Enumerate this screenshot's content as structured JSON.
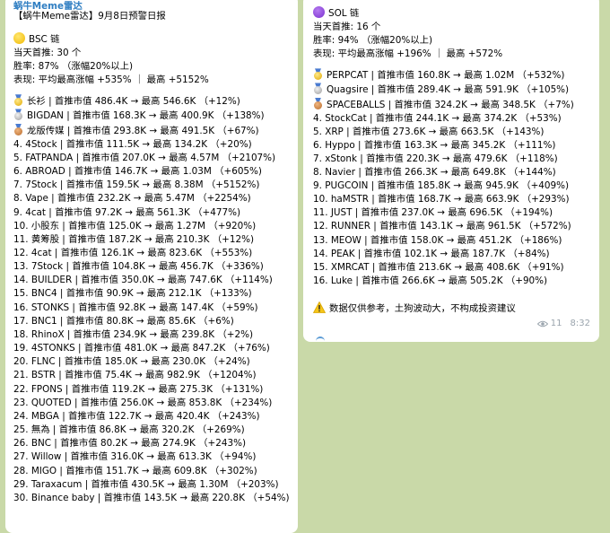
{
  "left": {
    "sender": "蜗牛Meme雷达",
    "title": "【蜗牛Meme雷达】9月8日预警日报",
    "chain": "BSC 链",
    "today": "当天首推: 30 个",
    "winrate": "胜率: 87% （涨幅20%以上)",
    "perf": "表现: 平均最高涨幅 +535% ｜ 最高 +5152%",
    "medal_rows": [
      {
        "medal": "gold",
        "text": "长衫 | 首推市值 486.4K → 最高 546.6K （+12%)"
      },
      {
        "medal": "silver",
        "text": "BIGDAN | 首推市值 168.3K → 最高 400.9K （+138%)"
      },
      {
        "medal": "bronze",
        "text": "龙版传媒 | 首推市值 293.8K → 最高 491.5K （+67%)"
      }
    ],
    "rows": [
      "4. 4Stock | 首推市值 111.5K → 最高 134.2K （+20%)",
      "5. FATPANDA | 首推市值 207.0K → 最高 4.57M （+2107%)",
      "6. ABROAD | 首推市值 146.7K → 最高 1.03M （+605%)",
      "7. 7Stock | 首推市值 159.5K → 最高 8.38M （+5152%)",
      "8. Vape | 首推市值 232.2K → 最高 5.47M （+2254%)",
      "9. 4cat | 首推市值 97.2K → 最高 561.3K （+477%)",
      "10. 小股东 | 首推市值 125.0K → 最高 1.27M （+920%)",
      "11. 黄筹股 | 首推市值 187.2K → 最高 210.3K （+12%)",
      "12. 4cat | 首推市值 126.1K → 最高 823.6K （+553%)",
      "13. 7Stock | 首推市值 104.8K → 最高 456.7K （+336%)",
      "14. BUILDER | 首推市值 350.0K → 最高 747.6K （+114%)",
      "15. BNC4 | 首推市值 90.9K → 最高 212.1K （+133%)",
      "16. STONKS | 首推市值 92.8K → 最高 147.4K （+59%)",
      "17. BNC1 | 首推市值 80.8K → 最高 85.6K （+6%)",
      "18. RhinoX | 首推市值 234.9K → 最高 239.8K （+2%)",
      "19. 4STONKS | 首推市值 481.0K → 最高 847.2K （+76%)",
      "20. FLNC | 首推市值 185.0K → 最高 230.0K （+24%)",
      "21. BSTR | 首推市值 75.4K → 最高 982.9K （+1204%)",
      "22. FPONS | 首推市值 119.2K → 最高 275.3K （+131%)",
      "23. QUOTED | 首推市值 256.0K → 最高 853.8K （+234%)",
      "24. MBGA | 首推市值 122.7K → 最高 420.4K （+243%)",
      "25. 無為 | 首推市值 86.8K → 最高 320.2K （+269%)",
      "26. BNC | 首推市值 80.2K → 最高 274.9K （+243%)",
      "27. Willow | 首推市值 316.0K → 最高 613.3K （+94%)",
      "28. MIGO | 首推市值 151.7K → 最高 609.8K （+302%)",
      "29. Taraxacum | 首推市值 430.5K → 最高 1.30M （+203%)",
      "30. Binance baby | 首推市值 143.5K → 最高 220.8K （+54%)"
    ]
  },
  "right": {
    "chain": "SOL 链",
    "today": "当天首推: 16 个",
    "winrate": "胜率: 94% （涨幅20%以上)",
    "perf": "表现: 平均最高涨幅 +196% ｜ 最高 +572%",
    "medal_rows": [
      {
        "medal": "gold",
        "text": "PERPCAT | 首推市值 160.8K → 最高 1.02M （+532%)"
      },
      {
        "medal": "silver",
        "text": "Quagsire | 首推市值 289.4K → 最高 591.9K （+105%)"
      },
      {
        "medal": "bronze",
        "text": "SPACEBALLS | 首推市值 324.2K → 最高 348.5K （+7%)"
      }
    ],
    "rows": [
      "4. StockCat | 首推市值 244.1K → 最高 374.2K （+53%)",
      "5. XRP | 首推市值 273.6K → 最高 663.5K （+143%)",
      "6. Hyppo | 首推市值 163.3K → 最高 345.2K （+111%)",
      "7. xStonk | 首推市值 220.3K → 最高 479.6K （+118%)",
      "8. Navier | 首推市值 266.3K → 最高 649.8K （+144%)",
      "9. PUGCOIN | 首推市值 185.8K → 最高 945.9K （+409%)",
      "10. haMSTR | 首推市值 168.7K → 最高 663.9K （+293%)",
      "11. JUST | 首推市值 237.0K → 最高 696.5K （+194%)",
      "12. RUNNER | 首推市值 143.1K → 最高 961.5K （+572%)",
      "13. MEOW | 首推市值 158.0K → 最高 451.2K （+186%)",
      "14. PEAK | 首推市值 102.1K → 最高 187.7K （+84%)",
      "15. XMRCAT | 首推市值 213.6K → 最高 408.6K （+91%)",
      "16. Luke | 首推市值 266.6K → 最高 505.2K （+90%)"
    ],
    "disclaimer": "数据仅供参考，土狗波动大，不构成投资建议",
    "views": "11",
    "time": "8:32"
  },
  "icons": {
    "bsc": "yellow-circle-icon",
    "sol": "purple-circle-icon",
    "warning": "warning-icon",
    "views": "eye-icon"
  }
}
